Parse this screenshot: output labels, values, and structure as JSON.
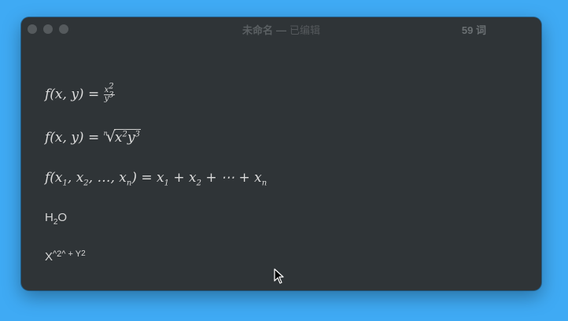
{
  "window": {
    "title": "未命名",
    "separator": "—",
    "status": "已编辑",
    "word_count": "59 词"
  },
  "formulas": {
    "f1_lhs": "f(x, y) = ",
    "f1_num_base": "x",
    "f1_num_exp": "2",
    "f1_den_base": "y",
    "f1_den_exp": "3",
    "f2_lhs": "f(x, y) = ",
    "f2_index": "n",
    "f2_radicand_a": "x",
    "f2_exp_a": "2",
    "f2_radicand_b": "y",
    "f2_exp_b": "3",
    "f3_lhs": "f(x",
    "f3_sub1": "1",
    "f3_mid1": ", x",
    "f3_sub2": "2",
    "f3_mid2": ", …, x",
    "f3_subn": "n",
    "f3_mid3": ") = x",
    "f3_rsub1": "1",
    "f3_mid4": " + x",
    "f3_rsub2": "2",
    "f3_mid5": " + ⋯ + x",
    "f3_rsubn": "n"
  },
  "text_lines": {
    "h2o_h": "H",
    "h2o_sub": "2",
    "h2o_o": "O",
    "xy_x": "X",
    "xy_mid": "^2^ + Y",
    "xy_sup": "2"
  },
  "colors": {
    "desktop": "#3faaf4",
    "window_bg": "#2f3437",
    "text": "#d6d6d6"
  },
  "icons": {
    "cursor": "arrow-cursor-icon"
  }
}
